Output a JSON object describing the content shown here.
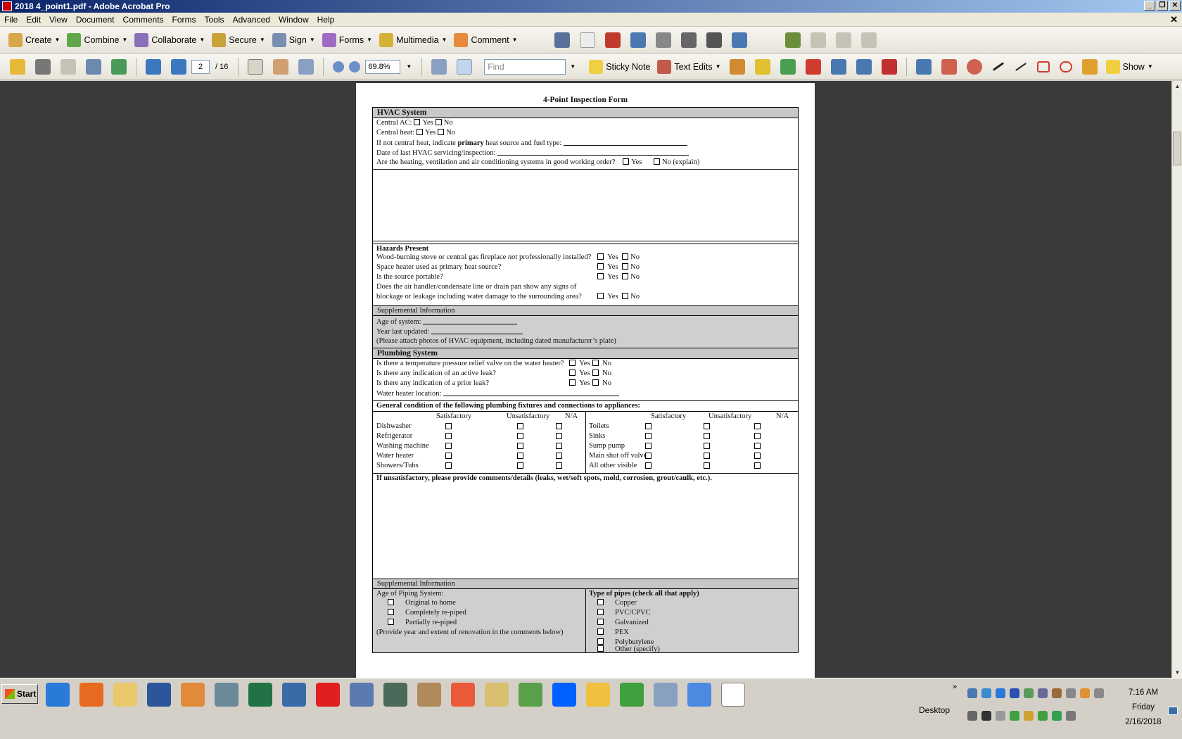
{
  "window": {
    "title": "2018 4_point1.pdf - Adobe Acrobat Pro"
  },
  "menu": [
    "File",
    "Edit",
    "View",
    "Document",
    "Comments",
    "Forms",
    "Tools",
    "Advanced",
    "Window",
    "Help"
  ],
  "toolbar1": {
    "create": "Create",
    "combine": "Combine",
    "collaborate": "Collaborate",
    "secure": "Secure",
    "sign": "Sign",
    "forms": "Forms",
    "multimedia": "Multimedia",
    "comment": "Comment"
  },
  "toolbar2": {
    "page_current": "2",
    "page_total": "/ 16",
    "zoom": "69.8%",
    "find_placeholder": "Find",
    "sticky_note": "Sticky Note",
    "text_edits": "Text Edits",
    "show": "Show"
  },
  "form": {
    "title": "4-Point Inspection Form",
    "hvac": {
      "heading": "HVAC System",
      "central_ac": "Central AC:",
      "central_heat": "Central heat:",
      "yes": "Yes",
      "no": "No",
      "primary_pre": "If not central heat, indicate ",
      "primary_bold": "primary",
      "primary_post": " heat source and fuel type:",
      "last_service": "Date of last HVAC servicing/inspection:",
      "good_order": "Are the heating, ventilation and air conditioning systems in good working order?",
      "no_explain": "No (explain)"
    },
    "hazards": {
      "heading": "Hazards Present",
      "q1_pre": "Wood-burning stove or central gas fireplace ",
      "q1_italic": "not",
      "q1_post": " professionally installed?",
      "q2": "Space heater used as primary heat source?",
      "q3": "Is the source portable?",
      "q4a": "Does the air handler/condensate line or drain pan show any signs of",
      "q4b": "blockage or leakage including water damage to the surrounding area?"
    },
    "hvac_supp": {
      "heading": "Supplemental Information",
      "age": "Age of system:",
      "updated": "Year last updated:",
      "photos": "(Please attach photos of HVAC equipment, including dated manufacturer’s plate)"
    },
    "plumbing": {
      "heading": "Plumbing System",
      "q1": "Is there a temperature pressure relief valve on the water heater?",
      "q2": "Is there any indication of an active leak?",
      "q3": "Is there any indication of a prior leak?",
      "location": "Water heater location:",
      "general": "General condition of the following plumbing fixtures and connections to appliances:",
      "col_sat": "Satisfactory",
      "col_unsat": "Unsatisfactory",
      "col_na": "N/A",
      "left_items": [
        "Dishwasher",
        "Refrigerator",
        "Washing machine",
        "Water heater",
        "Showers/Tubs"
      ],
      "right_items": [
        "Toilets",
        "Sinks",
        "Sump pump",
        "Main shut off valve",
        "All other visible"
      ],
      "comments": "If unsatisfactory, please provide comments/details (leaks, wet/soft spots, mold, corrosion, grout/caulk, etc.)."
    },
    "plumb_supp": {
      "heading": "Supplemental Information",
      "age_head": "Age of Piping System:",
      "age_opts": [
        "Original to home",
        "Completely re-piped",
        "Partially re-piped"
      ],
      "age_note": "(Provide year and extent of renovation in the comments below)",
      "type_head": "Type of pipes (check all that apply)",
      "type_opts": [
        "Copper",
        "PVC/CPVC",
        "Galvanized",
        "PEX",
        "Polybutylene",
        "Other (specify)"
      ]
    }
  },
  "taskbar": {
    "start": "Start",
    "desktop": "Desktop",
    "time": "7:16 AM",
    "day": "Friday",
    "date": "2/16/2018"
  },
  "colors": {
    "title_bar": "#0a246a",
    "doc_bg": "#3a3a3a",
    "form_gray": "#c8c8c8"
  }
}
